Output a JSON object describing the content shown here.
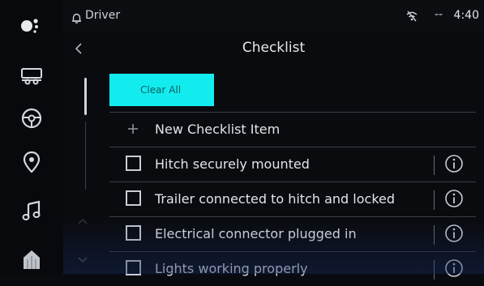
{
  "status_bar": {
    "profile": "Driver",
    "signal": "--",
    "time": "4:40"
  },
  "header": {
    "title": "Checklist"
  },
  "actions": {
    "clear_all": "Clear All"
  },
  "new_item": {
    "label": "New Checklist Item"
  },
  "checklist": [
    {
      "label": "Hitch securely mounted",
      "checked": false
    },
    {
      "label": "Trailer connected to hitch and locked",
      "checked": false
    },
    {
      "label": "Electrical connector plugged in",
      "checked": false
    },
    {
      "label": "Lights working properly",
      "checked": false
    }
  ],
  "sidebar": {
    "items": [
      {
        "icon": "assistant-dots-icon"
      },
      {
        "icon": "trailer-icon"
      },
      {
        "icon": "steering-wheel-icon"
      },
      {
        "icon": "location-pin-icon"
      },
      {
        "icon": "music-note-icon"
      },
      {
        "icon": "home-icon"
      }
    ]
  },
  "colors": {
    "accent": "#13ecef",
    "accent_text": "#0b5d63",
    "background": "#0a0b0f"
  }
}
